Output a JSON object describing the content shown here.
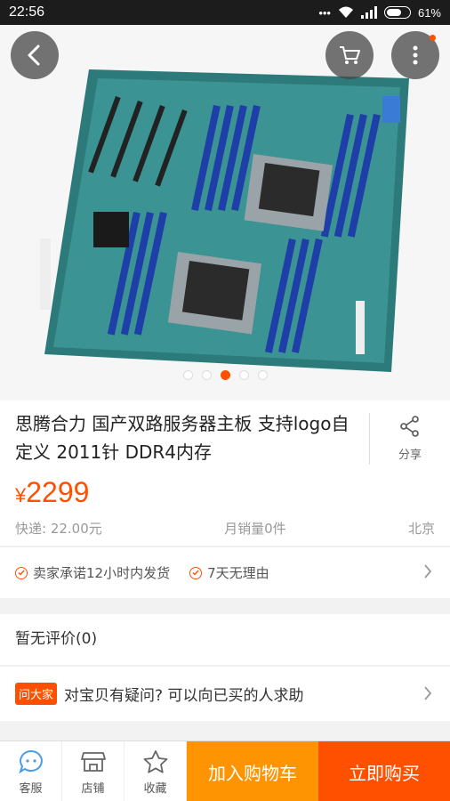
{
  "status": {
    "time": "22:56",
    "battery": "61%"
  },
  "hero": {
    "slides": 5,
    "active_slide": 3
  },
  "product": {
    "title": "思腾合力 国产双路服务器主板 支持logo自定义 2011针 DDR4内存",
    "currency": "¥",
    "price": "2299",
    "shipping": "快递: 22.00元",
    "monthly_sales": "月销量0件",
    "location": "北京"
  },
  "share_label": "分享",
  "promises": [
    "卖家承诺12小时内发货",
    "7天无理由"
  ],
  "reviews_label": "暂无评价(0)",
  "qa": {
    "badge": "问大家",
    "text": "对宝贝有疑问? 可以向已买的人求助"
  },
  "bottom": {
    "service": "客服",
    "shop": "店铺",
    "favorite": "收藏",
    "add_cart": "加入购物车",
    "buy_now": "立即购买"
  },
  "colors": {
    "accent": "#ff5000",
    "cart": "#ff9402"
  }
}
